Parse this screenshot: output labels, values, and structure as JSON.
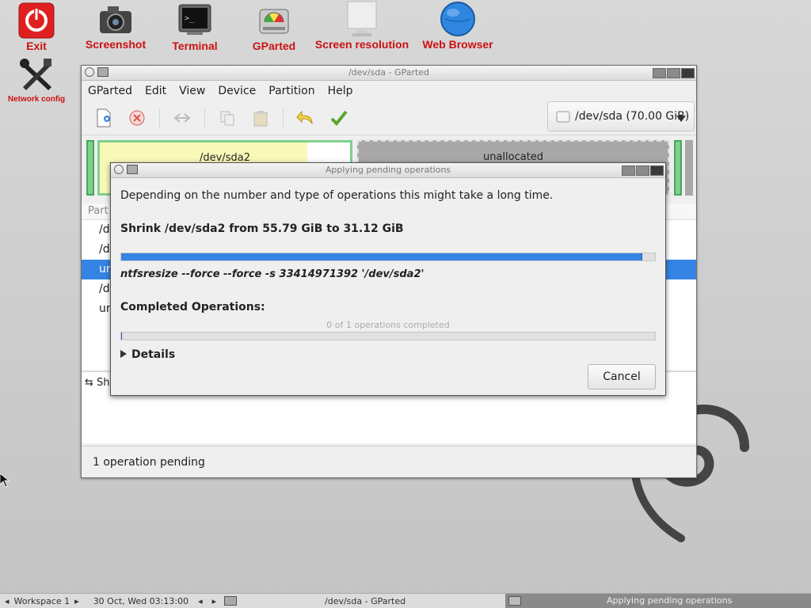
{
  "desktop": {
    "icons": [
      {
        "label": "Exit",
        "icon": "power-icon"
      },
      {
        "label": "Screenshot",
        "icon": "camera-icon"
      },
      {
        "label": "Terminal",
        "icon": "terminal-icon"
      },
      {
        "label": "GParted",
        "icon": "disk-icon"
      },
      {
        "label": "Screen resolution",
        "icon": "monitor-icon"
      },
      {
        "label": "Web Browser",
        "icon": "globe-icon"
      },
      {
        "label": "Network config",
        "icon": "wrench-icon"
      }
    ]
  },
  "gparted": {
    "title": "/dev/sda - GParted",
    "menu": [
      "GParted",
      "Edit",
      "View",
      "Device",
      "Partition",
      "Help"
    ],
    "device": "/dev/sda (70.00 GiB)",
    "disk_segments": [
      {
        "label": "/dev/sda2"
      },
      {
        "label": "unallocated"
      }
    ],
    "list_header": "Part",
    "rows": [
      {
        "text": "/d",
        "selected": false
      },
      {
        "text": "/d",
        "selected": false
      },
      {
        "text": "ur",
        "selected": true
      },
      {
        "text": "/d",
        "selected": false
      },
      {
        "text": "ur",
        "selected": false
      }
    ],
    "pending_panel_label": "Sh",
    "status": "1 operation pending"
  },
  "dialog": {
    "title": "Applying pending operations",
    "intro": "Depending on the number and type of operations this might take a long time.",
    "operation": "Shrink /dev/sda2 from 55.79 GiB to 31.12 GiB",
    "progress": 0.975,
    "command": "ntfsresize --force --force -s 33414971392 '/dev/sda2'",
    "completed_heading": "Completed Operations:",
    "completed_text": "0 of 1 operations completed",
    "completed_progress": 0,
    "details_label": "Details",
    "cancel_label": "Cancel"
  },
  "taskbar": {
    "workspace": "Workspace 1",
    "clock": "30 Oct, Wed 03:13:00",
    "tasks": [
      "/dev/sda - GParted",
      "Applying pending operations"
    ]
  },
  "colors": {
    "accent": "#3584e4",
    "desktop_label": "#cc1111"
  }
}
